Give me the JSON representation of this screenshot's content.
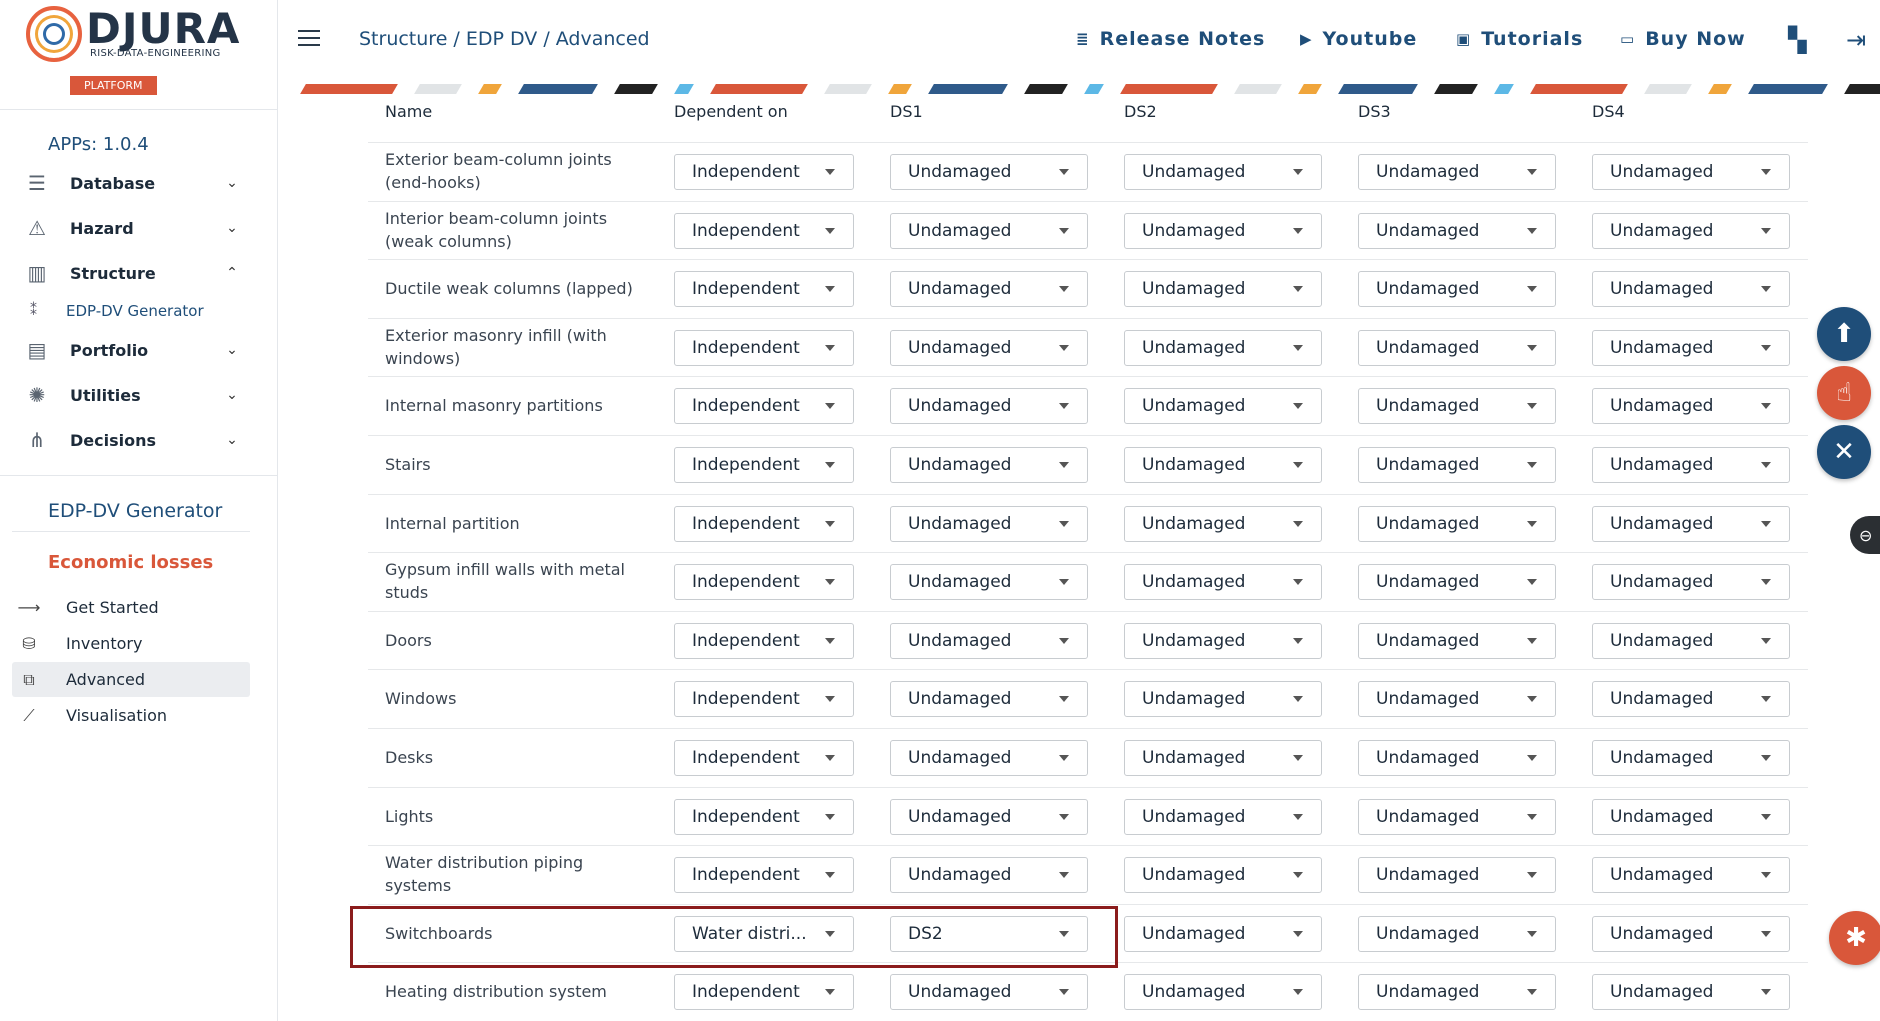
{
  "brand": {
    "name": "DJURA",
    "tagline": "RISK-DATA-ENGINEERING",
    "badge": "PLATFORM"
  },
  "sidebar": {
    "version": "APPs: 1.0.4",
    "nav": [
      {
        "label": "Database",
        "icon": "database-icon",
        "chevron": "⌄"
      },
      {
        "label": "Hazard",
        "icon": "hazard-warning-icon",
        "chevron": "⌄"
      },
      {
        "label": "Structure",
        "icon": "structure-chart-icon",
        "chevron": "⌃"
      },
      {
        "label": "Portfolio",
        "icon": "portfolio-icon",
        "chevron": "⌄"
      },
      {
        "label": "Utilities",
        "icon": "utilities-gear-icon",
        "chevron": "⌄"
      },
      {
        "label": "Decisions",
        "icon": "decisions-tree-icon",
        "chevron": "⌄"
      }
    ],
    "structure_sub": "EDP-DV Generator",
    "section_title": "EDP-DV Generator",
    "section_subtitle": "Economic losses",
    "menu": [
      {
        "label": "Get Started",
        "icon": "arrow-right-icon"
      },
      {
        "label": "Inventory",
        "icon": "inventory-db-icon"
      },
      {
        "label": "Advanced",
        "icon": "advanced-grid-icon"
      },
      {
        "label": "Visualisation",
        "icon": "line-chart-icon"
      }
    ]
  },
  "header": {
    "breadcrumb": "Structure / EDP DV / Advanced",
    "links": {
      "release_notes": "Release Notes",
      "youtube": "Youtube",
      "tutorials": "Tutorials",
      "buy_now": "Buy Now"
    }
  },
  "table": {
    "headers": {
      "name": "Name",
      "dependent": "Dependent on",
      "ds1": "DS1",
      "ds2": "DS2",
      "ds3": "DS3",
      "ds4": "DS4"
    },
    "rows": [
      {
        "name": "Exterior beam-column joints (end-hooks)",
        "dependent": "Independent",
        "ds1": "Undamaged",
        "ds2": "Undamaged",
        "ds3": "Undamaged",
        "ds4": "Undamaged"
      },
      {
        "name": "Interior beam-column joints (weak columns)",
        "dependent": "Independent",
        "ds1": "Undamaged",
        "ds2": "Undamaged",
        "ds3": "Undamaged",
        "ds4": "Undamaged"
      },
      {
        "name": "Ductile weak columns (lapped)",
        "dependent": "Independent",
        "ds1": "Undamaged",
        "ds2": "Undamaged",
        "ds3": "Undamaged",
        "ds4": "Undamaged"
      },
      {
        "name": "Exterior masonry infill (with windows)",
        "dependent": "Independent",
        "ds1": "Undamaged",
        "ds2": "Undamaged",
        "ds3": "Undamaged",
        "ds4": "Undamaged"
      },
      {
        "name": "Internal masonry partitions",
        "dependent": "Independent",
        "ds1": "Undamaged",
        "ds2": "Undamaged",
        "ds3": "Undamaged",
        "ds4": "Undamaged"
      },
      {
        "name": "Stairs",
        "dependent": "Independent",
        "ds1": "Undamaged",
        "ds2": "Undamaged",
        "ds3": "Undamaged",
        "ds4": "Undamaged"
      },
      {
        "name": "Internal partition",
        "dependent": "Independent",
        "ds1": "Undamaged",
        "ds2": "Undamaged",
        "ds3": "Undamaged",
        "ds4": "Undamaged"
      },
      {
        "name": "Gypsum infill walls with metal studs",
        "dependent": "Independent",
        "ds1": "Undamaged",
        "ds2": "Undamaged",
        "ds3": "Undamaged",
        "ds4": "Undamaged"
      },
      {
        "name": "Doors",
        "dependent": "Independent",
        "ds1": "Undamaged",
        "ds2": "Undamaged",
        "ds3": "Undamaged",
        "ds4": "Undamaged"
      },
      {
        "name": "Windows",
        "dependent": "Independent",
        "ds1": "Undamaged",
        "ds2": "Undamaged",
        "ds3": "Undamaged",
        "ds4": "Undamaged"
      },
      {
        "name": "Desks",
        "dependent": "Independent",
        "ds1": "Undamaged",
        "ds2": "Undamaged",
        "ds3": "Undamaged",
        "ds4": "Undamaged"
      },
      {
        "name": "Lights",
        "dependent": "Independent",
        "ds1": "Undamaged",
        "ds2": "Undamaged",
        "ds3": "Undamaged",
        "ds4": "Undamaged"
      },
      {
        "name": "Water distribution piping systems",
        "dependent": "Independent",
        "ds1": "Undamaged",
        "ds2": "Undamaged",
        "ds3": "Undamaged",
        "ds4": "Undamaged"
      },
      {
        "name": "Switchboards",
        "dependent": "Water distri...",
        "ds1": "DS2",
        "ds2": "Undamaged",
        "ds3": "Undamaged",
        "ds4": "Undamaged",
        "highlighted": true
      },
      {
        "name": "Heating distribution system",
        "dependent": "Independent",
        "ds1": "Undamaged",
        "ds2": "Undamaged",
        "ds3": "Undamaged",
        "ds4": "Undamaged"
      }
    ]
  },
  "fabs": [
    {
      "name": "upload-fab",
      "icon": "upload-icon",
      "glyph": "⬆",
      "color": "#1f4e79"
    },
    {
      "name": "touch-fab",
      "icon": "touch-hand-icon",
      "glyph": "☝",
      "color": "#d9573a"
    },
    {
      "name": "close-fab",
      "icon": "close-icon",
      "glyph": "✕",
      "color": "#1f4e79"
    },
    {
      "name": "bug-report-fab",
      "icon": "bug-icon",
      "glyph": "✱",
      "color": "#d9573a"
    }
  ],
  "colors": {
    "primary": "#1f4e79",
    "accent": "#d9573a",
    "highlight_border": "#8b1c1c"
  }
}
